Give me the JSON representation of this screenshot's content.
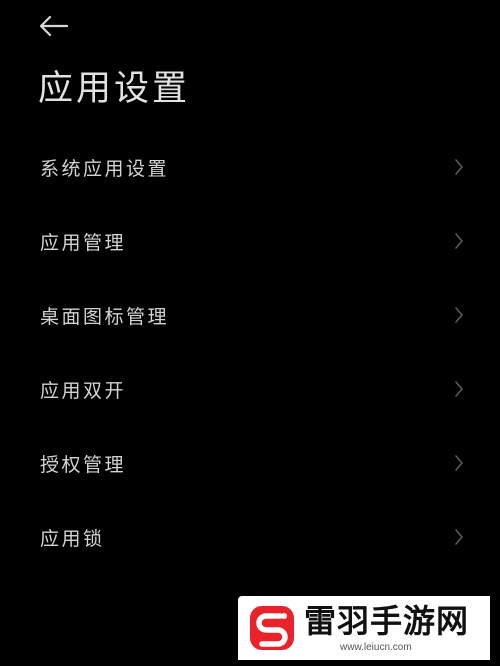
{
  "header": {
    "back_icon": "arrow-left-icon",
    "title": "应用设置"
  },
  "settings": {
    "chevron_icon": "chevron-right-icon",
    "items": [
      {
        "label": "系统应用设置"
      },
      {
        "label": "应用管理"
      },
      {
        "label": "桌面图标管理"
      },
      {
        "label": "应用双开"
      },
      {
        "label": "授权管理"
      },
      {
        "label": "应用锁"
      }
    ]
  },
  "watermark": {
    "name": "雷羽手游网",
    "url": "www.leiucn.com"
  },
  "colors": {
    "background": "#000000",
    "text": "#d4d4d4",
    "chevron": "#5a5a5a",
    "logo_red": "#e8242a"
  }
}
